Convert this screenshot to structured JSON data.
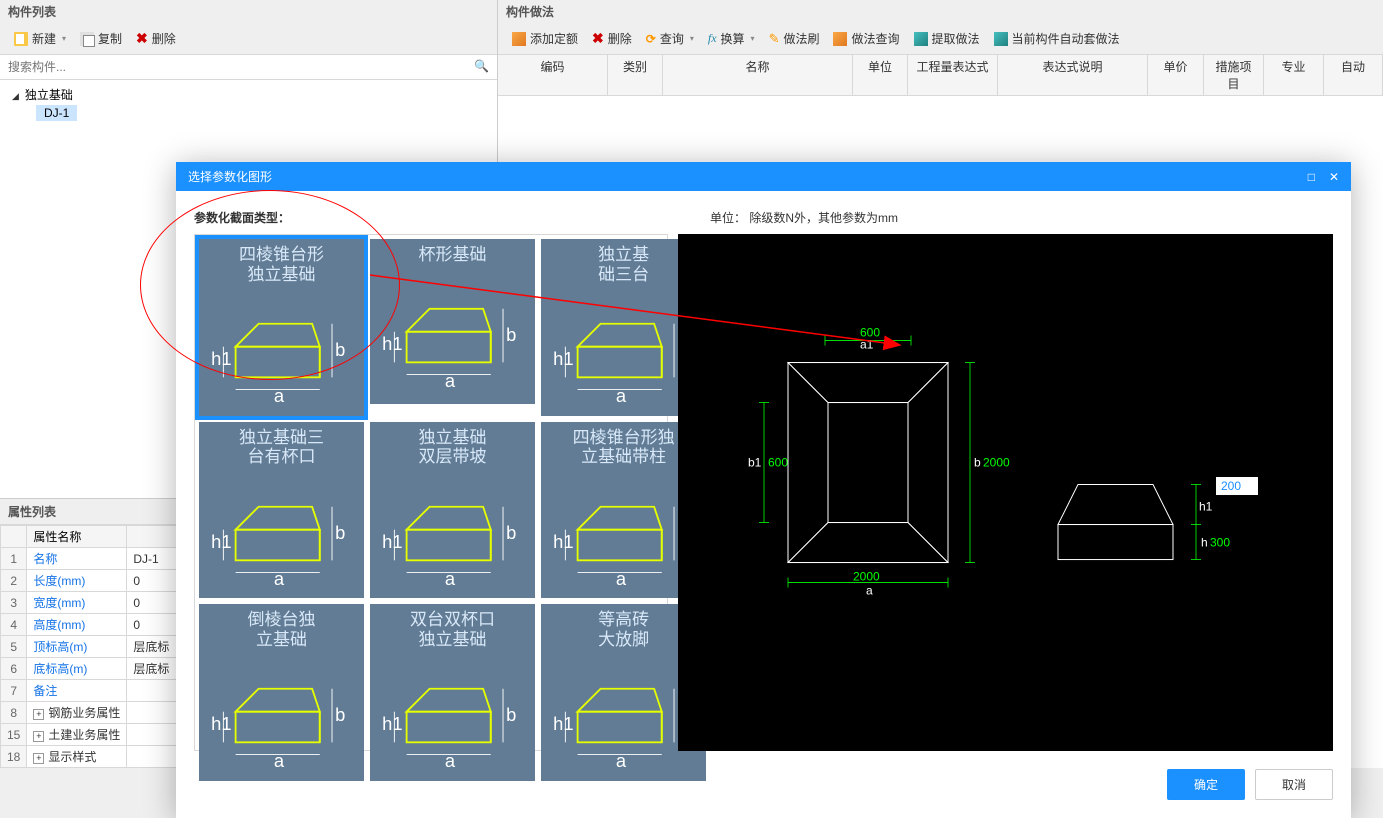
{
  "leftPanel": {
    "title": "构件列表",
    "toolbar": {
      "new": "新建",
      "copy": "复制",
      "delete": "删除"
    },
    "searchPlaceholder": "搜索构件...",
    "tree": {
      "parent": "独立基础",
      "child": "DJ-1"
    }
  },
  "propsPanel": {
    "title": "属性列表",
    "headers": {
      "name": "属性名称"
    },
    "rows": [
      {
        "idx": "1",
        "name": "名称",
        "value": "DJ-1",
        "link": true
      },
      {
        "idx": "2",
        "name": "长度(mm)",
        "value": "0",
        "link": true
      },
      {
        "idx": "3",
        "name": "宽度(mm)",
        "value": "0",
        "link": true
      },
      {
        "idx": "4",
        "name": "高度(mm)",
        "value": "0",
        "link": true
      },
      {
        "idx": "5",
        "name": "顶标高(m)",
        "value": "层底标",
        "link": true
      },
      {
        "idx": "6",
        "name": "底标高(m)",
        "value": "层底标",
        "link": true
      },
      {
        "idx": "7",
        "name": "备注",
        "value": "",
        "link": true
      },
      {
        "idx": "8",
        "name": "钢筋业务属性",
        "value": "",
        "expand": true
      },
      {
        "idx": "15",
        "name": "土建业务属性",
        "value": "",
        "expand": true
      },
      {
        "idx": "18",
        "name": "显示样式",
        "value": "",
        "expand": true
      }
    ]
  },
  "rightPanel": {
    "title": "构件做法",
    "toolbar": {
      "addQuota": "添加定额",
      "delete": "删除",
      "query": "查询",
      "convert": "换算",
      "brush": "做法刷",
      "methodQuery": "做法查询",
      "extract": "提取做法",
      "currentAuto": "当前构件自动套做法"
    },
    "tableHeaders": [
      "编码",
      "类别",
      "名称",
      "单位",
      "工程量表达式",
      "表达式说明",
      "单价",
      "措施项目",
      "专业",
      "自动"
    ]
  },
  "dialog": {
    "title": "选择参数化图形",
    "paramLabel": "参数化截面类型：",
    "unitLabel": "单位：  除级数N外，其他参数为mm",
    "shapes": [
      "四棱锥台形独立基础",
      "杯形基础",
      "独立基础三台",
      "独立基础三台有杯口",
      "独立基础双层带坡",
      "四棱锥台形独立基础带柱",
      "倒棱台独立基础",
      "双台双杯口独立基础",
      "等高砖大放脚"
    ],
    "preview": {
      "a": "2000",
      "a1": "600",
      "b": "2000",
      "b1": "600",
      "h": "300",
      "h1": "200"
    },
    "previewInput": "200",
    "footer": {
      "ok": "确定",
      "cancel": "取消"
    }
  }
}
